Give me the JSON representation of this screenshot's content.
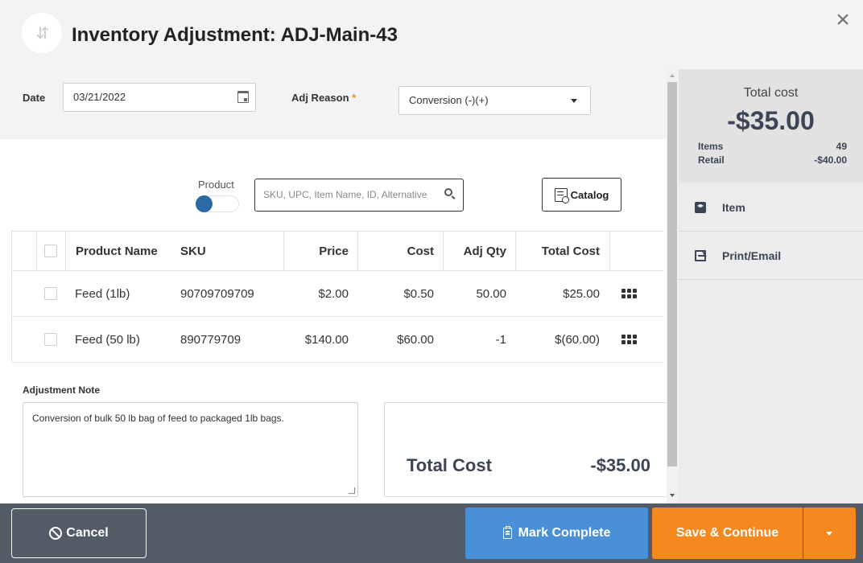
{
  "header": {
    "title": "Inventory Adjustment: ADJ-Main-43",
    "icon": "swap-arrows-icon",
    "close": "×"
  },
  "form": {
    "date_label": "Date",
    "date_value": "03/21/2022",
    "reason_label": "Adj Reason",
    "required_mark": "*",
    "reason_value": "Conversion (-)(+)"
  },
  "search": {
    "toggle_label": "Product",
    "placeholder": "SKU, UPC, Item Name, ID, Alternative",
    "catalog_label": "Catalog"
  },
  "table": {
    "headers": {
      "name": "Product Name",
      "sku": "SKU",
      "price": "Price",
      "cost": "Cost",
      "adj_qty": "Adj Qty",
      "total_cost": "Total Cost"
    },
    "rows": [
      {
        "name": "Feed (1lb)",
        "sku": "90709709709",
        "price": "$2.00",
        "cost": "$0.50",
        "adj_qty": "50.00",
        "total_cost": "$25.00"
      },
      {
        "name": "Feed (50 lb)",
        "sku": "890779709",
        "price": "$140.00",
        "cost": "$60.00",
        "adj_qty": "-1",
        "total_cost": "$(60.00)"
      }
    ]
  },
  "note": {
    "label": "Adjustment Note",
    "text": "Conversion of bulk 50 lb bag of feed to packaged 1lb bags."
  },
  "totals": {
    "label": "Total Cost",
    "value": "-$35.00"
  },
  "sidebar": {
    "title": "Total cost",
    "value": "-$35.00",
    "items_label": "Items",
    "items_value": "49",
    "retail_label": "Retail",
    "retail_value": "-$40.00",
    "menu": [
      {
        "label": "Item",
        "icon": "box-icon"
      },
      {
        "label": "Print/Email",
        "icon": "print-email-icon"
      }
    ]
  },
  "footer": {
    "cancel": "Cancel",
    "mark_complete": "Mark Complete",
    "save_continue": "Save & Continue"
  },
  "colors": {
    "primary_blue": "#4a90d6",
    "accent_orange": "#f5891f",
    "footer_bg": "#535b66",
    "toggle_blue": "#2c6aa6"
  }
}
